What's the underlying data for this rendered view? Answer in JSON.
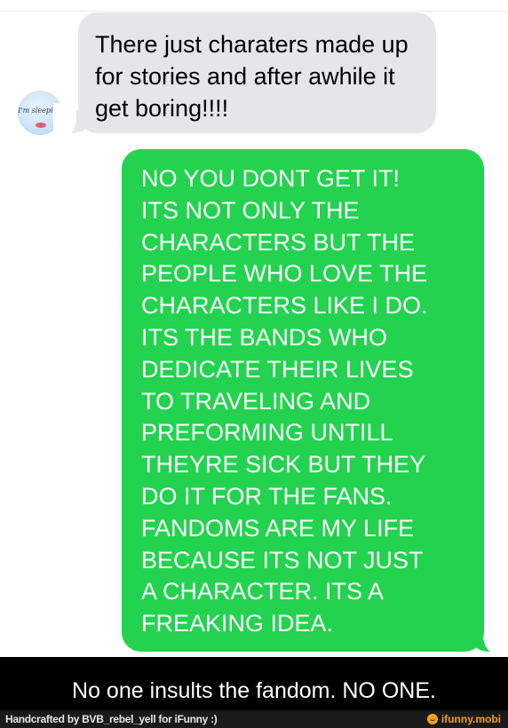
{
  "conversation": {
    "avatar": {
      "text": "I'm sleeping",
      "icon": "contact-avatar"
    },
    "messages": [
      {
        "direction": "incoming",
        "text": "There just charaters made up for stories and after awhile it get boring!!!!"
      },
      {
        "direction": "outgoing",
        "text": "NO YOU DONT GET IT!\nITS NOT ONLY THE\nCHARACTERS BUT THE\nPEOPLE WHO LOVE THE\nCHARACTERS LIKE I DO.\nITS THE BANDS WHO\nDEDICATE THEIR LIVES\nTO TRAVELING AND\nPREFORMING UNTILL\nTHEYRE SICK BUT THEY\nDO IT FOR THE FANS.\nFANDOMS ARE MY LIFE\nBECAUSE ITS NOT JUST\nA CHARACTER. ITS A\nFREAKING IDEA."
      }
    ]
  },
  "caption": "No one insults the fandom. NO ONE.",
  "footer": {
    "credit": "Handcrafted by BVB_rebel_yell for iFunny :)",
    "brand": "ifunny.mobi",
    "brand_icon": "ifunny-smiley-icon"
  },
  "colors": {
    "incoming_bubble": "#e5e5ea",
    "outgoing_bubble": "#23d34f",
    "brand": "#f6a019"
  }
}
